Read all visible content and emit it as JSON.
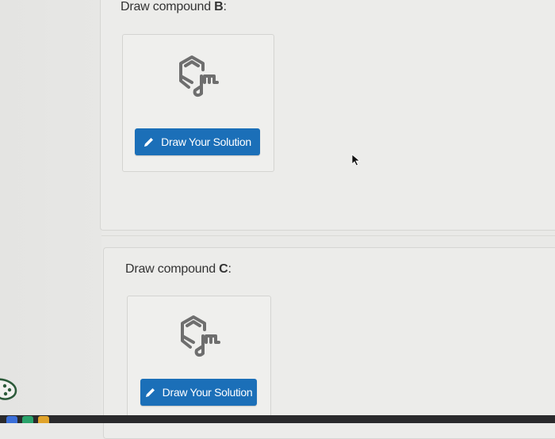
{
  "question_b": {
    "prefix": "Draw compound ",
    "letter": "B",
    "suffix": ":"
  },
  "question_c": {
    "prefix": "Draw compound ",
    "letter": "C",
    "suffix": ":"
  },
  "buttons": {
    "draw_solution_b": "Draw Your Solution",
    "draw_solution_c": "Draw Your Solution"
  },
  "icons": {
    "molecule": "molecule-draw-icon",
    "pencil": "pencil-icon",
    "cursor": "arrow-cursor-icon"
  },
  "colors": {
    "button_bg": "#1b6fb8",
    "button_text": "#ffffff",
    "taskbar": "#2a2a2c"
  }
}
